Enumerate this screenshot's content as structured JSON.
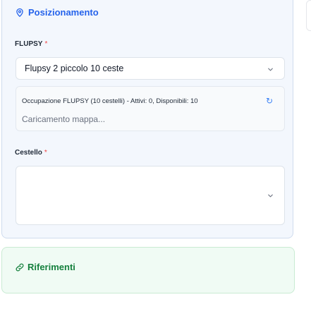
{
  "positioning": {
    "title": "Posizionamento",
    "flupsy_label": "FLUPSY",
    "required_mark": "*",
    "flupsy_value": "Flupsy 2 piccolo 10 ceste",
    "map_info": "Occupazione FLUPSY (10 cestelli) - Attivi: 0, Disponibili: 10",
    "refresh_glyph": "↻",
    "map_loading": "Caricamento mappa...",
    "cestello_label": "Cestello",
    "cestello_value": ""
  },
  "references": {
    "title": "Riferimenti"
  },
  "colors": {
    "accent_blue": "#2563eb",
    "accent_green": "#15803d",
    "required": "#ef4444"
  },
  "icons": [
    "location-pin-icon",
    "chevron-down-icon",
    "refresh-icon",
    "link-icon"
  ]
}
